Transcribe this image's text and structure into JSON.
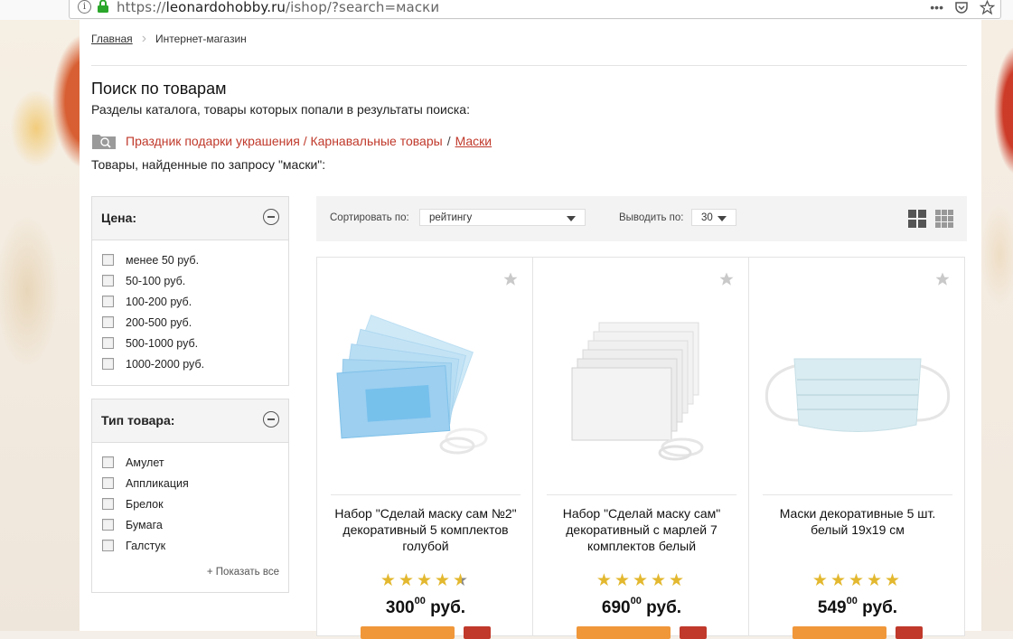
{
  "browser": {
    "url_prefix": "https://",
    "url_host": "leonardohobby.ru",
    "url_path": "/ishop/?search=маски",
    "menu_glyph": "•••"
  },
  "breadcrumb": {
    "home": "Главная",
    "current": "Интернет-магазин"
  },
  "page": {
    "title": "Поиск по товарам",
    "subtitle": "Разделы каталога, товары которых попали в результаты поиска:",
    "category_path": "Праздник подарки украшения / Карнавальные товары",
    "category_sep": "/",
    "category_leaf": "Маски",
    "found_text": "Товары, найденные по запросу \"маски\":"
  },
  "filters": {
    "price": {
      "title": "Цена:",
      "items": [
        "менее 50 руб.",
        "50-100 руб.",
        "100-200 руб.",
        "200-500 руб.",
        "500-1000 руб.",
        "1000-2000 руб."
      ]
    },
    "type": {
      "title": "Тип товара:",
      "items": [
        "Амулет",
        "Аппликация",
        "Брелок",
        "Бумага",
        "Галстук"
      ],
      "show_all": "+ Показать все"
    }
  },
  "sortbar": {
    "sort_label": "Сортировать по:",
    "sort_value": "рейтингу",
    "per_label": "Выводить по:",
    "per_value": "30"
  },
  "products": [
    {
      "name": "Набор \"Сделай маску сам №2\" декоративный 5 комплектов голубой",
      "rating": 4.5,
      "price_int": "300",
      "price_frac": "00",
      "currency": "руб."
    },
    {
      "name": "Набор \"Сделай маску сам\" декоративный с марлей 7 комплектов белый",
      "rating": 5,
      "price_int": "690",
      "price_frac": "00",
      "currency": "руб."
    },
    {
      "name": "Маски декоративные 5 шт. белый 19x19 см",
      "rating": 5,
      "price_int": "549",
      "price_frac": "00",
      "currency": "руб."
    }
  ],
  "colors": {
    "link_red": "#c0392b",
    "star_gold": "#e3b82f",
    "buy_orange": "#f0973a"
  }
}
